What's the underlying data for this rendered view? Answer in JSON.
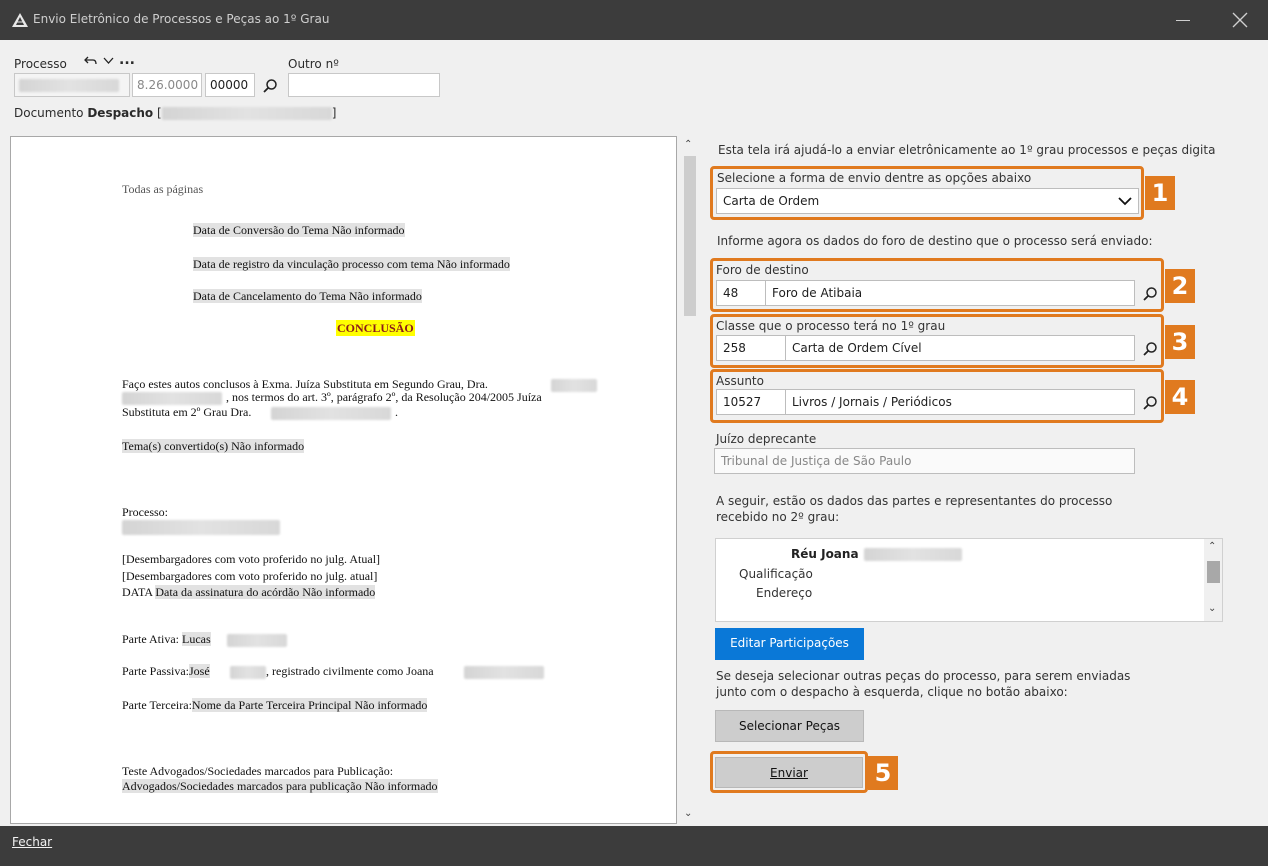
{
  "window": {
    "title": "Envio Eletrônico de Processos e Peças ao 1º Grau"
  },
  "header": {
    "processo_label": "Processo",
    "processo_segment1": "8.26.0000",
    "processo_segment2": "00000",
    "outro_label": "Outro nº",
    "more_label": "...",
    "documento_label": "Documento",
    "documento_value": "Despacho",
    "documento_open": "[",
    "documento_close": "]"
  },
  "document": {
    "lines": {
      "todas": "Todas as páginas",
      "conv": "Data de Conversão do Tema Não informado",
      "reg": "Data de registro da vinculação processo com tema Não informado",
      "canc": "Data de Cancelamento do Tema Não informado",
      "conclusao": "CONCLUSÃO",
      "faco1": "Faço estes autos conclusos à Exma. Juíza Substituta em Segundo Grau, Dra.",
      "faco2": ", nos termos do art. 3º, parágrafo 2º, da Resolução 204/2005 Juíza",
      "faco3": "Substituta em 2º Grau Dra.",
      "faco3_end": ".",
      "tema": "Tema(s) convertido(s) Não informado",
      "processo": "Processo:",
      "desemb1": "[Desembargadores com voto proferido no julg. Atual]",
      "desemb2": "[Desembargadores com voto proferido no julg. atual]",
      "data_prefix": "DATA ",
      "data_value": "Data da assinatura do acórdão Não informado",
      "ativa_prefix": "Parte Ativa: ",
      "ativa_value": "Lucas",
      "passiva_prefix": "Parte Passiva:",
      "passiva_value": "José",
      "passiva_mid": ", registrado civilmente como Joana",
      "terceira_prefix": "Parte Terceira:",
      "terceira_value": "Nome da Parte Terceira Principal Não informado",
      "teste": "Teste Advogados/Sociedades marcados para Publicação:",
      "advs": "Advogados/Sociedades marcados para publicação Não informado"
    }
  },
  "form": {
    "intro": "Esta tela irá ajudá-lo a enviar eletrônicamente ao 1º grau processos e peças digita",
    "forma_label": "Selecione a forma de envio dentre as opções abaixo",
    "forma_value": "Carta de Ordem",
    "informe": "Informe agora os dados do foro de destino que o processo será enviado:",
    "foro_label": "Foro de destino",
    "foro_code": "48",
    "foro_name": "Foro de Atibaia",
    "classe_label": "Classe que o processo terá no 1º grau",
    "classe_code": "258",
    "classe_name": "Carta de Ordem Cível",
    "assunto_label": "Assunto",
    "assunto_code": "10527",
    "assunto_name": "Livros / Jornais / Periódicos",
    "juizo_label": "Juízo deprecante",
    "juizo_value": "Tribunal de Justiça de São Paulo",
    "partes_intro1": "A seguir, estão os dados das partes e representantes do processo",
    "partes_intro2": "recebido no 2º grau:",
    "parts": {
      "reu_label": "Réu Joana",
      "qualificacao": "Qualificação",
      "endereco": "Endereço"
    },
    "editar_btn": "Editar Participações",
    "pecas_intro1": "Se deseja selecionar outras peças do processo, para serem enviadas",
    "pecas_intro2": "junto com o despacho à esquerda,  clique no botão abaixo:",
    "selecionar_btn": "Selecionar Peças",
    "enviar_btn": "Enviar"
  },
  "callouts": [
    "1",
    "2",
    "3",
    "4",
    "5"
  ],
  "footer": {
    "fechar": "Fechar"
  },
  "colors": {
    "accent_orange": "#e07a1f",
    "button_blue": "#0a78d7",
    "titlebar": "#3c3c3c",
    "highlight_yellow": "#ffff00"
  }
}
